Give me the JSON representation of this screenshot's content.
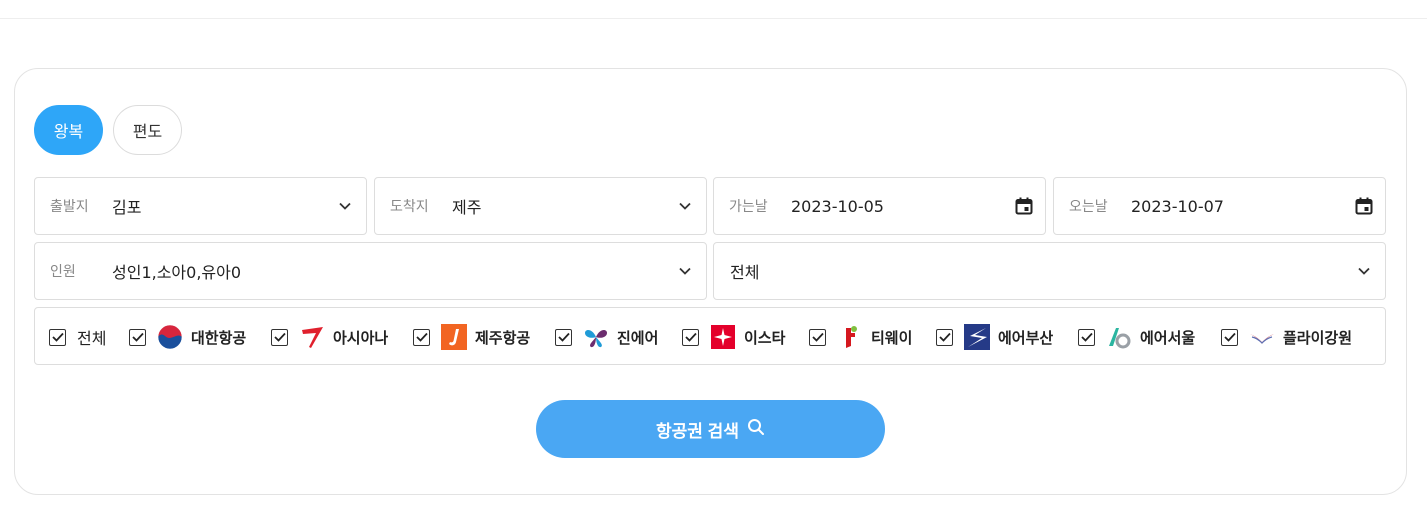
{
  "trip_types": [
    {
      "label": "왕복",
      "active": true
    },
    {
      "label": "편도",
      "active": false
    }
  ],
  "departure": {
    "label": "출발지",
    "value": "김포"
  },
  "arrival": {
    "label": "도착지",
    "value": "제주"
  },
  "go_date": {
    "label": "가는날",
    "value": "2023-10-05"
  },
  "return_date": {
    "label": "오는날",
    "value": "2023-10-07"
  },
  "passengers": {
    "label": "인원",
    "value": "성인1,소아0,유아0"
  },
  "seat_class": {
    "value": "전체"
  },
  "airlines": {
    "all_label": "전체",
    "items": [
      {
        "name": "대한항공",
        "checked": true,
        "icon": "korean-air-logo"
      },
      {
        "name": "아시아나",
        "checked": true,
        "icon": "asiana-logo"
      },
      {
        "name": "제주항공",
        "checked": true,
        "icon": "jeju-air-logo"
      },
      {
        "name": "진에어",
        "checked": true,
        "icon": "jin-air-logo"
      },
      {
        "name": "이스타",
        "checked": true,
        "icon": "eastar-logo"
      },
      {
        "name": "티웨이",
        "checked": true,
        "icon": "tway-logo"
      },
      {
        "name": "에어부산",
        "checked": true,
        "icon": "air-busan-logo"
      },
      {
        "name": "에어서울",
        "checked": true,
        "icon": "air-seoul-logo"
      },
      {
        "name": "플라이강원",
        "checked": true,
        "icon": "fly-gangwon-logo"
      }
    ]
  },
  "search_button": {
    "label": "항공권 검색"
  },
  "colors": {
    "accent": "#2ea6f8",
    "search": "#4aa7f3"
  }
}
